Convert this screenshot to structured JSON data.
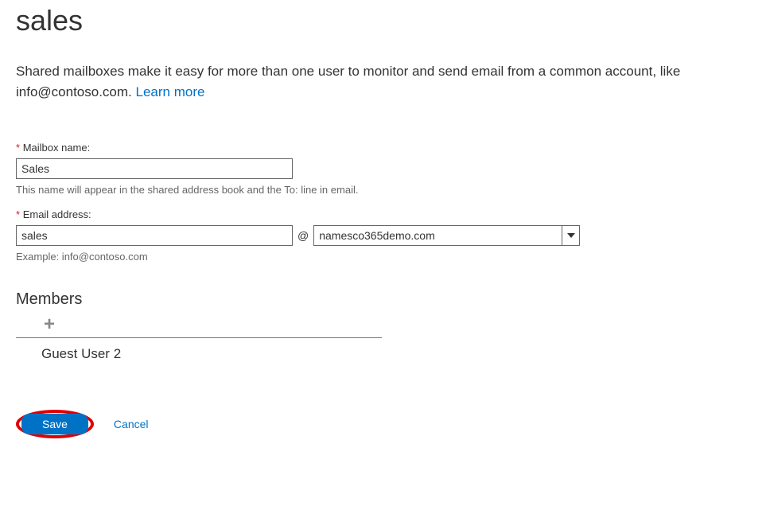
{
  "title": "sales",
  "description": {
    "text": "Shared mailboxes make it easy for more than one user to monitor and send email from a common account, like info@contoso.com. ",
    "learn_more": "Learn more"
  },
  "mailbox_name": {
    "label": "Mailbox name:",
    "value": "Sales",
    "hint": "This name will appear in the shared address book and the To: line in email."
  },
  "email_address": {
    "label": "Email address:",
    "local_value": "sales",
    "at": "@",
    "domain_value": "namesco365demo.com",
    "hint": "Example: info@contoso.com"
  },
  "members": {
    "heading": "Members",
    "add_glyph": "+",
    "items": [
      {
        "name": "Guest User 2"
      }
    ]
  },
  "actions": {
    "save": "Save",
    "cancel": "Cancel"
  },
  "required_marker": "*"
}
